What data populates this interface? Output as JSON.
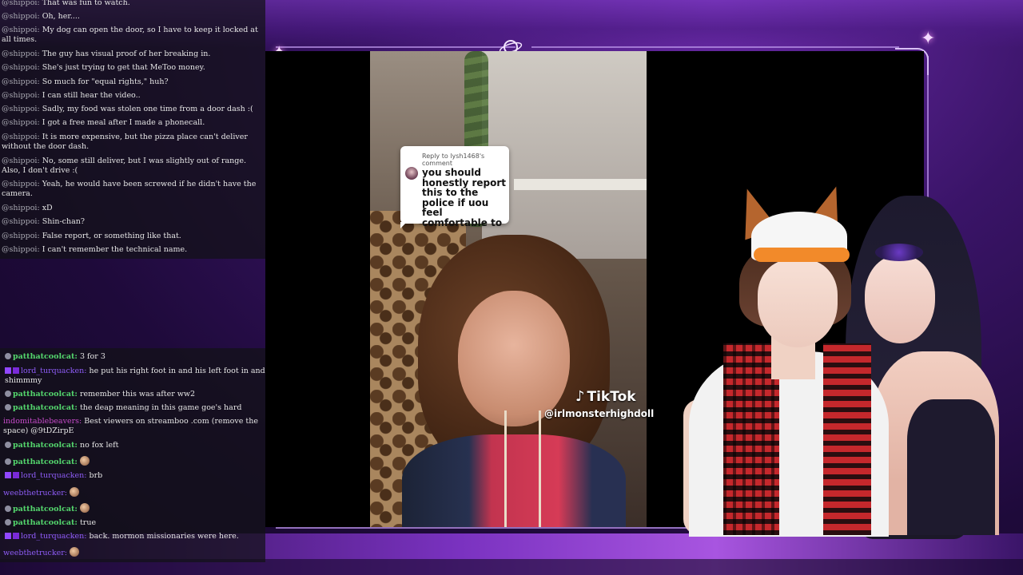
{
  "video": {
    "reply_header": "Reply to lysh1468's comment",
    "reply_text": "you should honestly report this to the police if uou feel comfortable to",
    "platform": "TikTok",
    "handle": "@irlmonsterhighdoll"
  },
  "chat_top": {
    "messages": [
      {
        "user": "@shippoi:",
        "text": "That was fun to watch."
      },
      {
        "user": "@shippoi:",
        "text": "Oh, her...."
      },
      {
        "user": "@shippoi:",
        "text": "My dog can open the door, so I have to keep it locked at all times."
      },
      {
        "user": "@shippoi:",
        "text": "The guy has visual proof of her breaking in."
      },
      {
        "user": "@shippoi:",
        "text": "She's just trying to get that MeToo money."
      },
      {
        "user": "@shippoi:",
        "text": "So much for \"equal rights,\" huh?"
      },
      {
        "user": "@shippoi:",
        "text": "I can still hear the video.."
      },
      {
        "user": "@shippoi:",
        "text": "Sadly, my food was stolen one time from a door dash :("
      },
      {
        "user": "@shippoi:",
        "text": "I got a free meal after I made a phonecall."
      },
      {
        "user": "@shippoi:",
        "text": "It is more expensive, but the pizza place can't deliver without the door dash."
      },
      {
        "user": "@shippoi:",
        "text": "No, some still deliver, but I was slightly out of range. Also, I don't drive :("
      },
      {
        "user": "@shippoi:",
        "text": "Yeah, he would have been screwed if he didn't have the camera."
      },
      {
        "user": "@shippoi:",
        "text": "xD"
      },
      {
        "user": "@shippoi:",
        "text": "Shin-chan?"
      },
      {
        "user": "@shippoi:",
        "text": "False report, or something like that."
      },
      {
        "user": "@shippoi:",
        "text": "I can't remember the technical name."
      }
    ]
  },
  "chat_bottom": {
    "messages": [
      {
        "user": "patthatcoolcat:",
        "text": "3 for 3"
      },
      {
        "user": "lord_turquacken:",
        "text": "he put his right foot in and his left foot in and shimmmy"
      },
      {
        "user": "patthatcoolcat:",
        "text": "remember this was after ww2"
      },
      {
        "user": "patthatcoolcat:",
        "text": "the deap meaning in this game goe's hard"
      },
      {
        "user": "indomitablebeavers:",
        "text": "Best viewers on streamboo .com (remove the space) @9tDZirpE"
      },
      {
        "user": "patthatcoolcat:",
        "text": "no fox left"
      },
      {
        "user": "patthatcoolcat:",
        "text": ""
      },
      {
        "user": "lord_turquacken:",
        "text": "brb"
      },
      {
        "user": "weebthetrucker:",
        "text": ""
      },
      {
        "user": "patthatcoolcat:",
        "text": ""
      },
      {
        "user": "patthatcoolcat:",
        "text": "true"
      },
      {
        "user": "lord_turquacken:",
        "text": "back. mormon missionaries were here."
      },
      {
        "user": "weebthetrucker:",
        "text": ""
      }
    ]
  },
  "colors": {
    "accent": "#7a32c0",
    "user_green": "#54d76d",
    "user_purple": "#8e5cf6",
    "user_pink": "#c74bc9"
  }
}
